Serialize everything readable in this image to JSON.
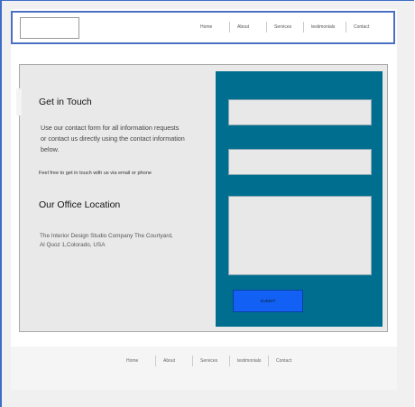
{
  "header": {
    "nav": [
      "Home",
      "About",
      "Services",
      "testimonials",
      "Contact"
    ]
  },
  "main": {
    "get_in_touch_title": "Get in Touch",
    "contact_paragraph": "Use our contact form for all information requests or contact us directly using the contact information below.",
    "email_phone_note": "Feel free to get in touch with us via email or phone",
    "office_title": "Our Office Location",
    "address": "The Interior Design Studio Company The Courtyard, Al Quoz 1,Colorado,  USA"
  },
  "form": {
    "submit_label": "SUBMIT",
    "panel_color": "#006f8f",
    "button_color": "#1261f4"
  },
  "footer": {
    "nav": [
      "Home",
      "About",
      "Services",
      "testimonials",
      "Contact"
    ]
  }
}
